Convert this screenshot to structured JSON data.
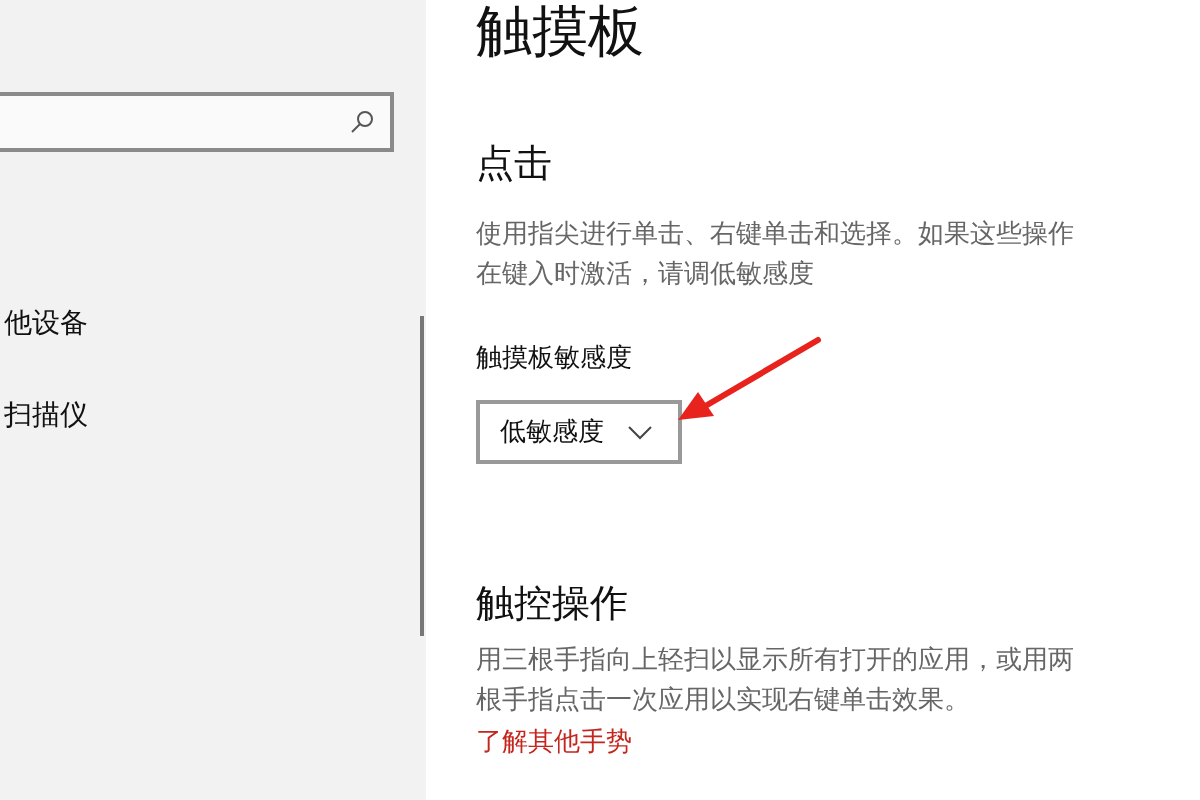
{
  "sidebar": {
    "items": [
      "他设备",
      "扫描仪"
    ]
  },
  "page": {
    "title": "触摸板",
    "sections": [
      {
        "heading": "点击",
        "description": "使用指尖进行单击、右键单击和选择。如果这些操作在键入时激活，请调低敏感度",
        "setting": {
          "label": "触摸板敏感度",
          "value": "低敏感度"
        }
      },
      {
        "heading": "触控操作",
        "description": "用三根手指向上轻扫以显示所有打开的应用，或用两根手指点击一次应用以实现右键单击效果。",
        "link": "了解其他手势"
      }
    ]
  }
}
